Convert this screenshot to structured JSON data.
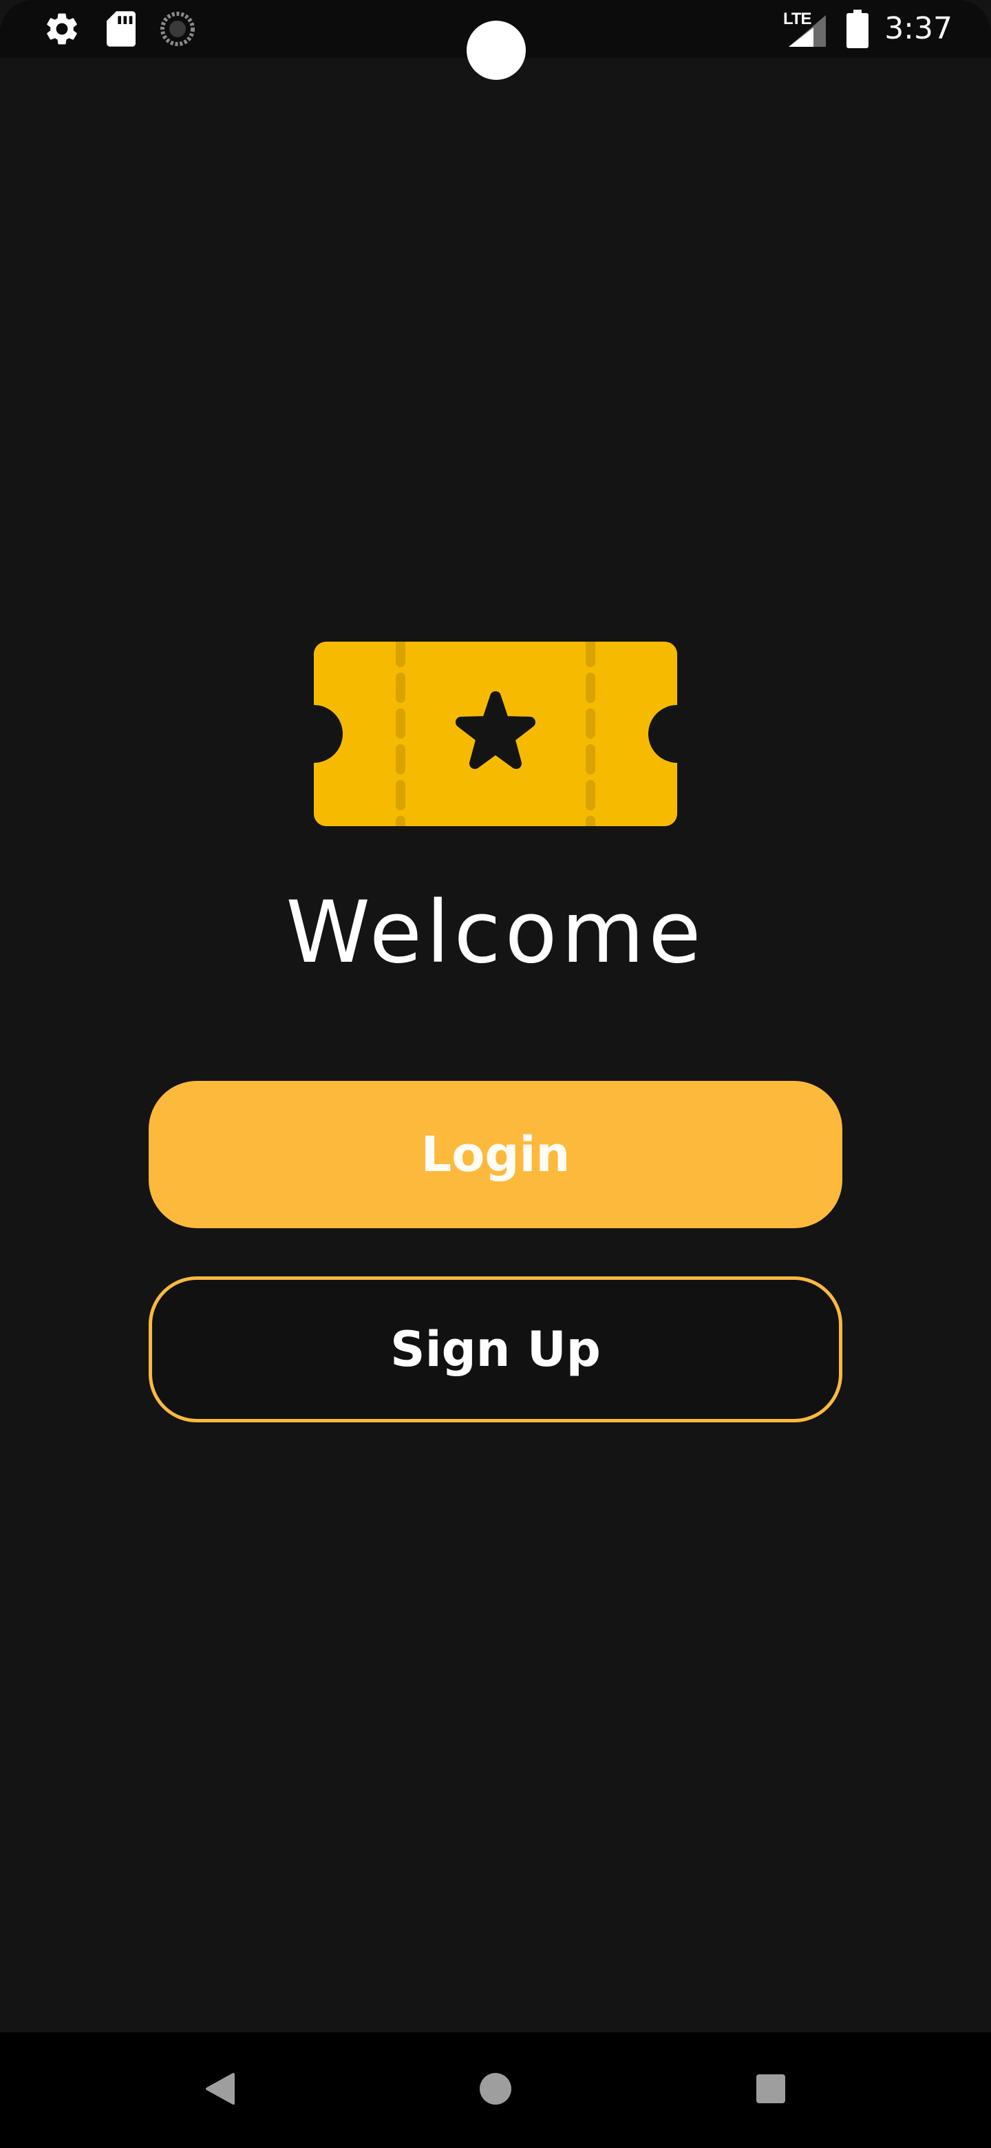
{
  "status_bar": {
    "time": "3:37",
    "network": "LTE",
    "icons": [
      "settings-icon",
      "sd-card-icon",
      "sync-icon",
      "cell-signal-icon",
      "battery-icon"
    ]
  },
  "welcome": {
    "title": "Welcome",
    "logo": "ticket-star-icon"
  },
  "buttons": {
    "login_label": "Login",
    "signup_label": "Sign Up"
  },
  "colors": {
    "accent": "#fdb93c",
    "logo": "#f6bb00",
    "background": "#141414"
  },
  "nav_bar": {
    "icons": [
      "back-icon",
      "home-icon",
      "recents-icon"
    ]
  }
}
